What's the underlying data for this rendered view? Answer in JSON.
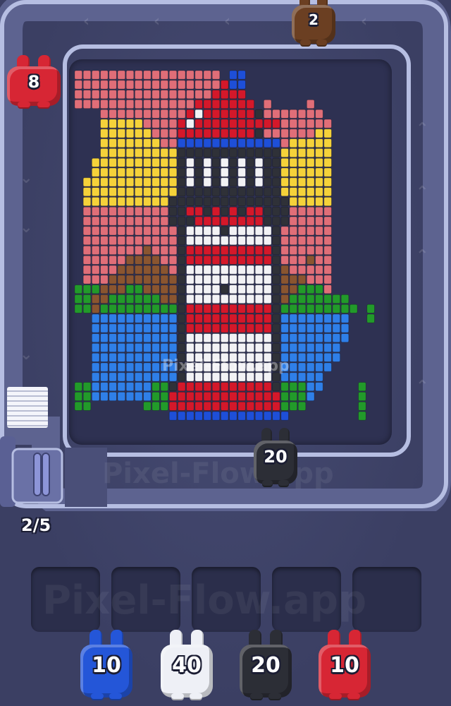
{
  "app": {
    "watermark": "Pixel-Flow.app",
    "watermark_track": "Pixel-Flow.app",
    "watermark_slots": "Pixel-Flow.app"
  },
  "colors": {
    "background": "#3b3f63",
    "track": "#aab2d8",
    "canvas": "#2e3152",
    "salmon": "#e06e78",
    "yellow": "#f5d23a",
    "red": "#d4182a",
    "white": "#f2f2f5",
    "black": "#2f3138",
    "blue": "#2f7fe8",
    "deep-blue": "#1e4fd8",
    "brown": "#8a5530",
    "green": "#229a2a"
  },
  "queue_counter": "2/5",
  "track_shooters": [
    {
      "name": "track-shooter-red",
      "color": "#d72634",
      "count": "8"
    },
    {
      "name": "track-shooter-brown",
      "color": "#6b3f22",
      "count": "2"
    },
    {
      "name": "track-shooter-black",
      "color": "#2c2e36",
      "count": "20"
    }
  ],
  "slots": [
    {
      "name": "slot-1",
      "state": "empty"
    },
    {
      "name": "slot-2",
      "state": "empty"
    },
    {
      "name": "slot-3",
      "state": "empty"
    },
    {
      "name": "slot-4",
      "state": "empty"
    },
    {
      "name": "slot-5",
      "state": "empty"
    }
  ],
  "deck_shooters": [
    {
      "name": "deck-shooter-blue",
      "color": "#2456d8",
      "count": "10"
    },
    {
      "name": "deck-shooter-white",
      "color": "#eef0f6",
      "count": "40"
    },
    {
      "name": "deck-shooter-black",
      "color": "#2c2e36",
      "count": "20"
    },
    {
      "name": "deck-shooter-red",
      "color": "#d72634",
      "count": "10"
    }
  ]
}
